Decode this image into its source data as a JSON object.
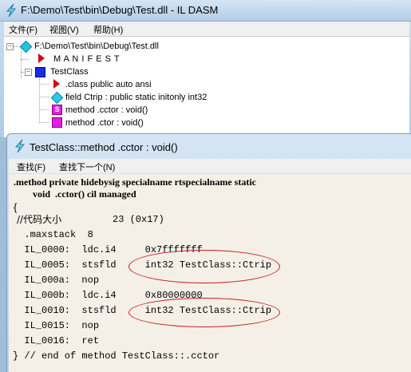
{
  "main_window": {
    "title": "F:\\Demo\\Test\\bin\\Debug\\Test.dll - IL DASM",
    "menu": [
      "文件(F)",
      "视图(V)",
      "帮助(H)"
    ],
    "tree": {
      "root": "F:\\Demo\\Test\\bin\\Debug\\Test.dll",
      "manifest": "M A N I F E S T",
      "class_name": "TestClass",
      "members": [
        ".class public auto ansi",
        "field Ctrip : public static initonly int32",
        "method .cctor : void()",
        "method .ctor : void()"
      ]
    }
  },
  "code_window": {
    "title": "TestClass::method .cctor : void()",
    "menu": [
      "查找(F)",
      "查找下一个(N)"
    ],
    "header": [
      ".method private hidebysig specialname rtspecialname static",
      "        void  .cctor() cil managed"
    ],
    "open_brace": "{",
    "code_size_comment": "//代码大小",
    "code_size_value": "23 (0x17)",
    "lines": [
      "  .maxstack  8",
      "  IL_0000:  ldc.i4     0x7fffffff",
      "  IL_0005:  stsfld     int32 TestClass::Ctrip",
      "  IL_000a:  nop",
      "  IL_000b:  ldc.i4     0x80000000",
      "  IL_0010:  stsfld     int32 TestClass::Ctrip",
      "  IL_0015:  nop",
      "  IL_0016:  ret"
    ],
    "end_line": "} // end of method TestClass::.cctor"
  },
  "colors": {
    "annotation_ellipse": "#c81d1d",
    "code_background": "#f4f0e8",
    "window_frame": "#b4cde6"
  },
  "icons": [
    "il-dasm-app-icon",
    "cyan-diamond-icon",
    "red-triangle-icon",
    "blue-square-icon",
    "cyan-field-icon",
    "static-method-icon",
    "method-icon"
  ]
}
